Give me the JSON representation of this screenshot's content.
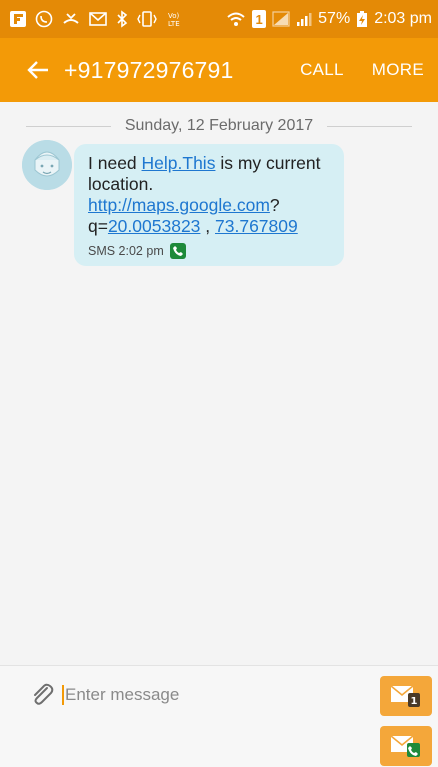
{
  "status_bar": {
    "battery": "57%",
    "time": "2:03 pm",
    "sim_badge": "1",
    "icons": [
      "flipboard-icon",
      "whatsapp-icon",
      "missed-call-icon",
      "message-icon",
      "bluetooth-icon",
      "vibrate-icon",
      "volte-icon",
      "wifi-icon",
      "sim1-icon",
      "signal-icon",
      "signal-icon",
      "battery-charging-icon"
    ]
  },
  "app_bar": {
    "title": "+917972976791",
    "call_label": "CALL",
    "more_label": "MORE",
    "color": "#f39a07"
  },
  "conversation": {
    "date": "Sunday, 12 February 2017",
    "message": {
      "text_1": "I need ",
      "link_help": "Help.This",
      "text_2": " is my current location. ",
      "link_url": "http://maps.google.com",
      "text_3": "?q=",
      "link_lat": "20.0053823",
      "text_4": " , ",
      "link_lng": "73.767809",
      "meta": "SMS 2:02 pm"
    }
  },
  "composer": {
    "placeholder": "Enter message"
  }
}
